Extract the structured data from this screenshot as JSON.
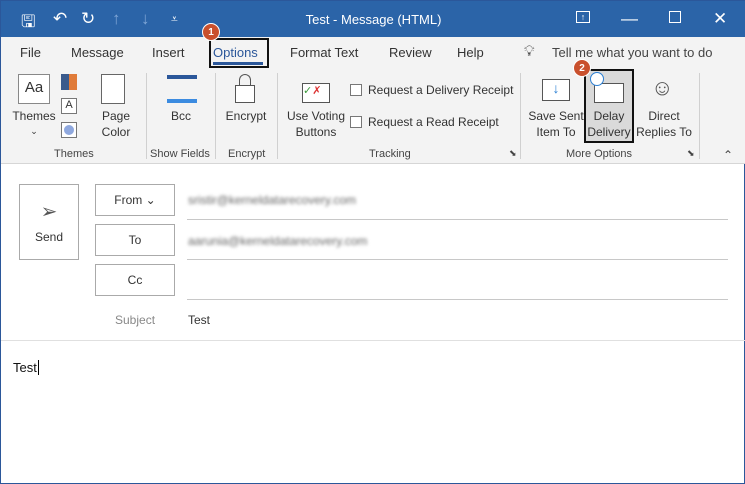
{
  "titlebar": {
    "title": "Test  -  Message (HTML)",
    "icons": [
      "save-icon",
      "undo-icon",
      "redo-icon",
      "up-arrow-icon",
      "down-arrow-icon",
      "customize-icon",
      "ribbon-display-icon",
      "minimize-icon",
      "maximize-icon",
      "close-icon"
    ]
  },
  "tabs": [
    "File",
    "Message",
    "Insert",
    "Options",
    "Format Text",
    "Review",
    "Help"
  ],
  "active_tab": "Options",
  "tell_me": "Tell me what you want to do",
  "ribbon": {
    "themes": {
      "label": "Themes",
      "group": "Themes",
      "page_color": "Page Color"
    },
    "bcc": {
      "label": "Bcc",
      "group": "Show Fields"
    },
    "encrypt": {
      "label": "Encrypt",
      "group": "Encrypt"
    },
    "voting": {
      "label1": "Use Voting",
      "label2": "Buttons"
    },
    "delivery_receipt": "Request a Delivery Receipt",
    "read_receipt": "Request a Read Receipt",
    "tracking_group": "Tracking",
    "save_sent": {
      "label1": "Save Sent",
      "label2": "Item To"
    },
    "delay": {
      "label1": "Delay",
      "label2": "Delivery"
    },
    "direct": {
      "label1": "Direct",
      "label2": "Replies To"
    },
    "more_group": "More Options"
  },
  "badges": [
    "1",
    "2"
  ],
  "compose": {
    "send": "Send",
    "from": "From",
    "to": "To",
    "cc": "Cc",
    "subject_label": "Subject",
    "from_value": "sristir@kerneldatarecovery.com",
    "to_value": "aarunia@kerneldatarecovery.com",
    "subject": "Test",
    "body": "Test"
  },
  "colors": {
    "titlebar": "#2b64a8",
    "badge": "#c9502d",
    "accent": "#2b579a"
  }
}
